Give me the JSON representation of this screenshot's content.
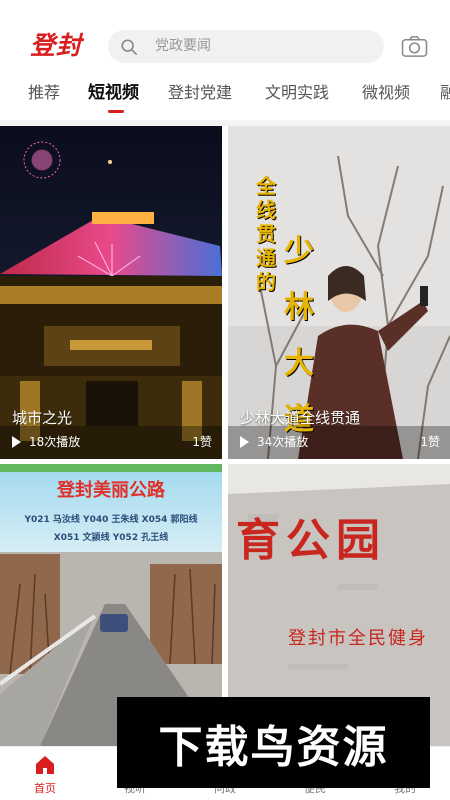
{
  "header": {
    "logo_text": "登封",
    "search_placeholder": "党政要闻"
  },
  "tabs": [
    {
      "label": "推荐"
    },
    {
      "label": "短视频"
    },
    {
      "label": "登封党建"
    },
    {
      "label": "文明实践"
    },
    {
      "label": "微视频"
    },
    {
      "label": "融"
    }
  ],
  "active_tab": "短视频",
  "cards": [
    {
      "title": "城市之光",
      "plays": "18次播放",
      "likes": "1赞"
    },
    {
      "title": "少林大道全线贯通",
      "plays": "34次播放",
      "likes": "1赞",
      "overlay_text_left": "全线贯通的",
      "overlay_text_right": "少林大道"
    },
    {
      "banner_title": "登封美丽公路",
      "routes_line1": "Y021 马汝线   Y040 王朱线   X054 郭阳线",
      "routes_line2": "X051 文颍线   Y052 孔王线"
    },
    {
      "sign_text": "育公园",
      "sign_sub": "登封市全民健身"
    }
  ],
  "bottom_nav": [
    {
      "label": "首页",
      "icon": "home-icon"
    },
    {
      "label": "视听",
      "icon": "video-icon"
    },
    {
      "label": "问政",
      "icon": "question-icon"
    },
    {
      "label": "便民",
      "icon": "service-icon"
    },
    {
      "label": "我的",
      "icon": "user-icon"
    }
  ],
  "watermark": "下载鸟资源",
  "colors": {
    "accent": "#d81e1e",
    "search_bg": "#f1f1f1"
  }
}
